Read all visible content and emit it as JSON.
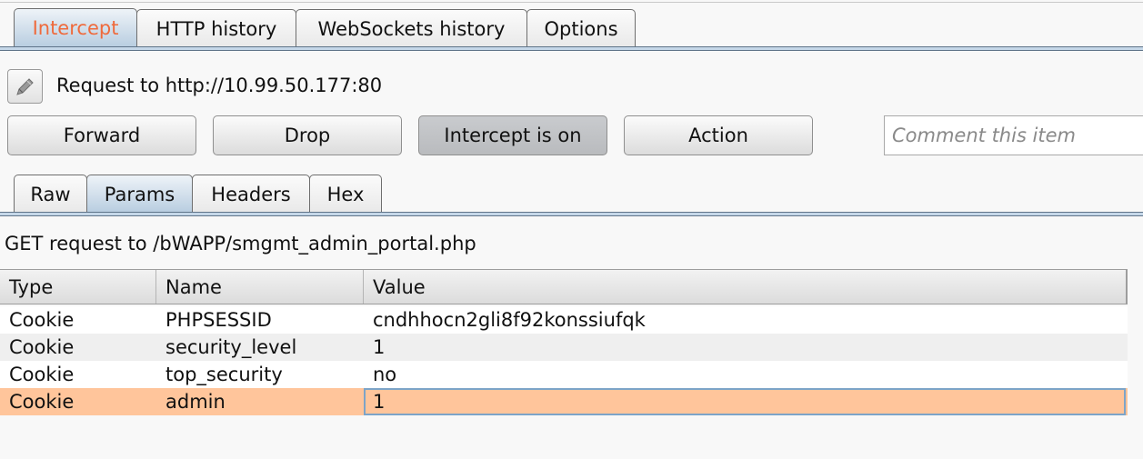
{
  "top_tabs": [
    "Intercept",
    "HTTP history",
    "WebSockets history",
    "Options"
  ],
  "active_top_tab": "Intercept",
  "request": {
    "label": "Request to http://10.99.50.177:80"
  },
  "buttons": {
    "forward": "Forward",
    "drop": "Drop",
    "intercept": "Intercept is on",
    "action": "Action"
  },
  "comment": {
    "placeholder": "Comment this item",
    "value": ""
  },
  "sub_tabs": [
    "Raw",
    "Params",
    "Headers",
    "Hex"
  ],
  "active_sub_tab": "Params",
  "request_summary": "GET request to /bWAPP/smgmt_admin_portal.php",
  "table": {
    "columns": [
      "Type",
      "Name",
      "Value"
    ],
    "rows": [
      {
        "type": "Cookie",
        "name": "PHPSESSID",
        "value": "cndhhocn2gli8f92konssiufqk"
      },
      {
        "type": "Cookie",
        "name": "security_level",
        "value": "1"
      },
      {
        "type": "Cookie",
        "name": "top_security",
        "value": "no"
      },
      {
        "type": "Cookie",
        "name": "admin",
        "value": "1"
      }
    ],
    "selected_row_index": 3
  },
  "colors": {
    "active_tab_text": "#ef6a3c",
    "selected_row": "#ffc59b",
    "tab_accent": "#c5d7e8"
  },
  "icons": {
    "edit": "pencil-icon"
  }
}
